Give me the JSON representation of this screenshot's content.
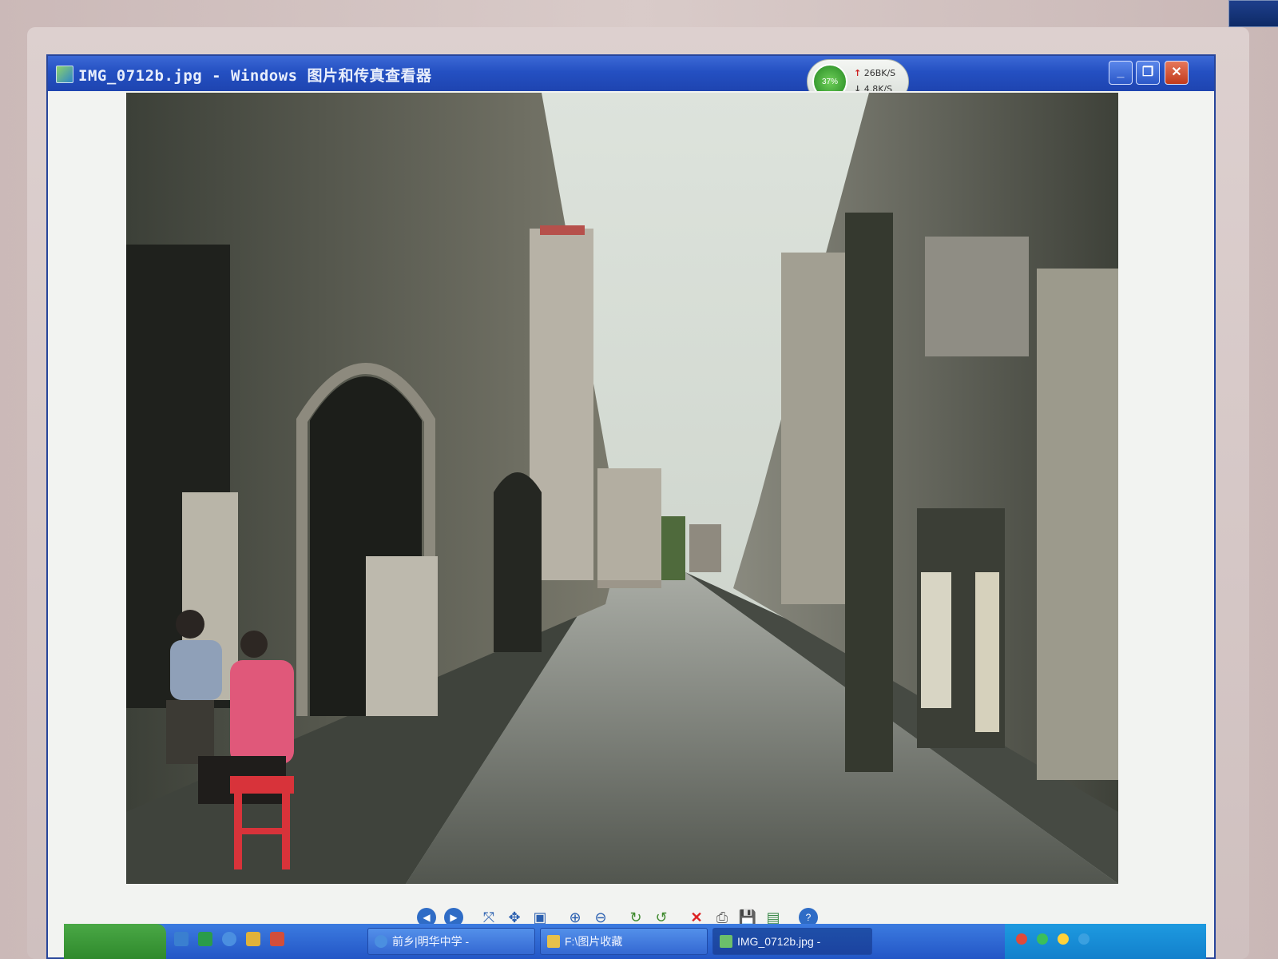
{
  "window": {
    "title": "IMG_0712b.jpg - Windows 图片和传真查看器"
  },
  "net_monitor": {
    "percent": "37%",
    "upload": "26BK/S",
    "download": "4.8K/S"
  },
  "window_buttons": {
    "minimize": "_",
    "restore": "❐",
    "close": "✕"
  },
  "toolbar": {
    "prev": "◀",
    "next": "▶",
    "best_fit": "⤧",
    "actual_size": "✥",
    "slideshow": "▣",
    "zoom_in": "⊕",
    "zoom_out": "⊖",
    "rotate_cw": "↻",
    "rotate_ccw": "↺",
    "delete": "✕",
    "print": "⎙",
    "save": "💾",
    "open_with": "▤",
    "help": "?"
  },
  "taskbar": {
    "tasks": [
      {
        "label": "前乡|明华中学 -"
      },
      {
        "label": "F:\\图片收藏"
      },
      {
        "label": "IMG_0712b.jpg - "
      }
    ]
  }
}
